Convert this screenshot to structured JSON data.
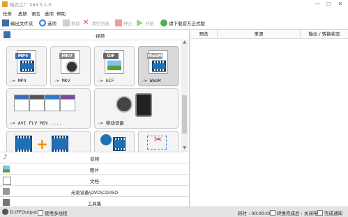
{
  "window": {
    "title": "格式工厂 X64 5.1.0",
    "min": "—",
    "max": "☐",
    "close": "✕"
  },
  "menu": [
    "任务",
    "皮肤",
    "语言",
    "选项",
    "帮助"
  ],
  "toolbar": {
    "output_folder": "输出文件夹",
    "options": "选项",
    "remove": "移除",
    "clear_list": "清空列表",
    "stop": "停止",
    "start": "开始",
    "download": "请下载官方正式版"
  },
  "left": {
    "section_title": "视频",
    "tiles": [
      {
        "label": "-> MP4",
        "badge": "MP4",
        "badge_color": "#3d6fb6"
      },
      {
        "label": "-> MKV",
        "badge": "MKV",
        "badge_color": "#8a8a8a"
      },
      {
        "label": "-> GIF",
        "badge": "GIF",
        "badge_color": "#6a6a6a"
      },
      {
        "label": "-> WebM",
        "badge": "WebM",
        "badge_color": "#9a9a9a"
      },
      {
        "label": "-> AVI FLV MOV ...."
      },
      {
        "label": "-> 移动设备"
      }
    ],
    "categories": [
      "音频",
      "图片",
      "文档",
      "光驱设备\\DVD\\CD\\ISO",
      "工具集"
    ]
  },
  "right": {
    "columns": [
      "预览",
      "来源",
      "输出 / 转换状态"
    ]
  },
  "status": {
    "output_path": "D:\\FFOutput",
    "multithread": "使用多线程",
    "elapsed": "耗时 : 00:00:00",
    "after_convert": "转换完成后 : 关闭电脑",
    "notify": "完成通知"
  }
}
